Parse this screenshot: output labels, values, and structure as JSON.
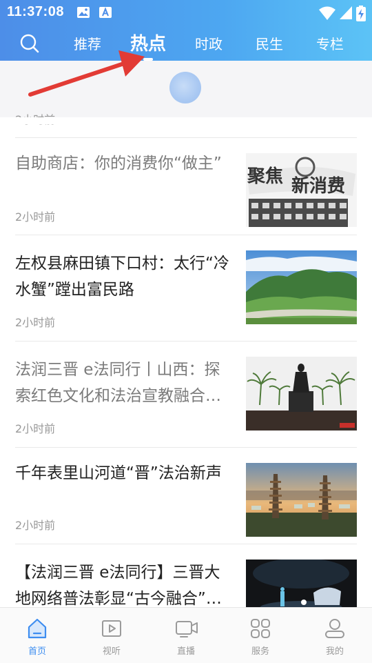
{
  "status_bar": {
    "time": "11:37:08"
  },
  "tabs": [
    {
      "label": "推荐"
    },
    {
      "label": "热点"
    },
    {
      "label": "时政"
    },
    {
      "label": "民生"
    },
    {
      "label": "专栏"
    }
  ],
  "active_tab": "热点",
  "refresh": {
    "previous_time": "2小时前"
  },
  "news": [
    {
      "title": "自助商店：你的消费你“做主”",
      "time": "2小时前",
      "read": true,
      "image_text": {
        "line1": "聚焦",
        "line2": "新消费"
      }
    },
    {
      "title": "左权县麻田镇下口村：太行“冷水蟹”蹚出富民路",
      "time": "2小时前",
      "read": false
    },
    {
      "title": "法润三晋 e法同行丨山西：探索红色文化和法治宣教融合…",
      "time": "2小时前",
      "read": true
    },
    {
      "title": "千年表里山河道“晋”法治新声",
      "time": "2小时前",
      "read": false
    },
    {
      "title": "【法润三晋 e法同行】三晋大地网络普法彰显“古今融合”…",
      "time": "",
      "read": false
    }
  ],
  "bottom_nav": [
    {
      "label": "首页",
      "active": true
    },
    {
      "label": "视听",
      "active": false
    },
    {
      "label": "直播",
      "active": false
    },
    {
      "label": "服务",
      "active": false
    },
    {
      "label": "我的",
      "active": false
    }
  ],
  "colors": {
    "header_start": "#4d8ee8",
    "header_end": "#5cc3f6",
    "accent": "#3d8df0",
    "annotation_arrow": "#e23b35"
  }
}
